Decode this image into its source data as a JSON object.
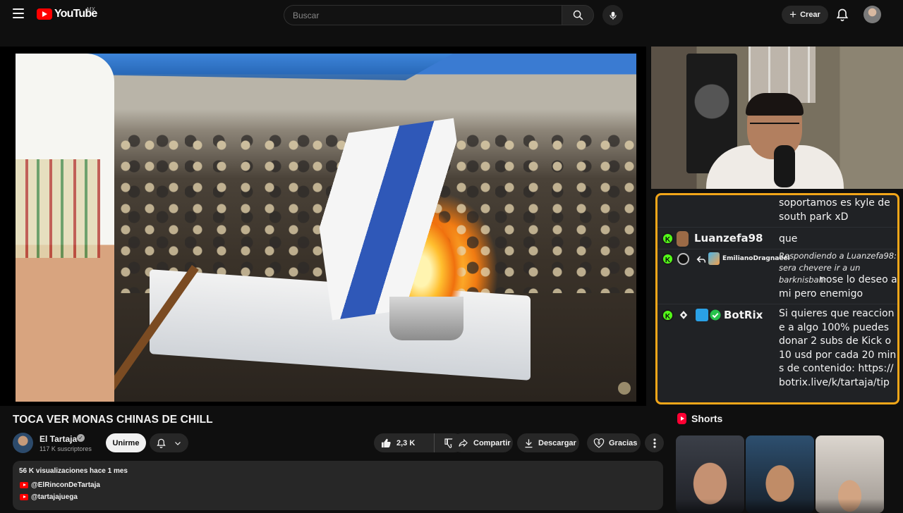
{
  "header": {
    "logo_text": "YouTube",
    "country_code": "MX",
    "search_placeholder": "Buscar",
    "create_label": "Crear"
  },
  "video": {
    "title": "TOCA VER MONAS CHINAS DE CHILL",
    "channel_name": "El Tartaja",
    "subscribers": "117 K suscriptores",
    "join_label": "Unirme",
    "likes": "2,3 K",
    "share_label": "Compartir",
    "download_label": "Descargar",
    "thanks_label": "Gracias"
  },
  "description": {
    "meta": "56 K visualizaciones  hace 1 mes",
    "links": [
      "@ElRinconDeTartaja",
      "@tartajajuega"
    ]
  },
  "chat": {
    "msg0": "soportamos es kyle de south park xD",
    "msg1_user": "Luanzefa98",
    "msg1_text": "que",
    "msg2_user": "EmilianoDragnaeel",
    "msg2_reply": "Respondiendo a Luanzefa98: sera chevere ir a un barknisbah:",
    "msg2_text": "nose lo deseo a mi pero enemigo",
    "msg3_user": "BotRix",
    "msg3_text": "Si quieres que reaccione a algo 100% puedes donar 2 subs de Kick o 10 usd por cada 20 mins de contenido: https://botrix.live/k/tartaja/tip",
    "badge_letter": "K"
  },
  "shorts": {
    "title": "Shorts"
  },
  "colors": {
    "accent_red": "#ff0000",
    "chat_border": "#f2a619",
    "kick_green": "#53fc18"
  },
  "icons": [
    "menu-icon",
    "youtube-logo-icon",
    "search-icon",
    "mic-icon",
    "plus-icon",
    "bell-icon",
    "verified-icon",
    "like-icon",
    "dislike-icon",
    "share-icon",
    "download-icon",
    "thanks-icon",
    "shorts-icon"
  ]
}
